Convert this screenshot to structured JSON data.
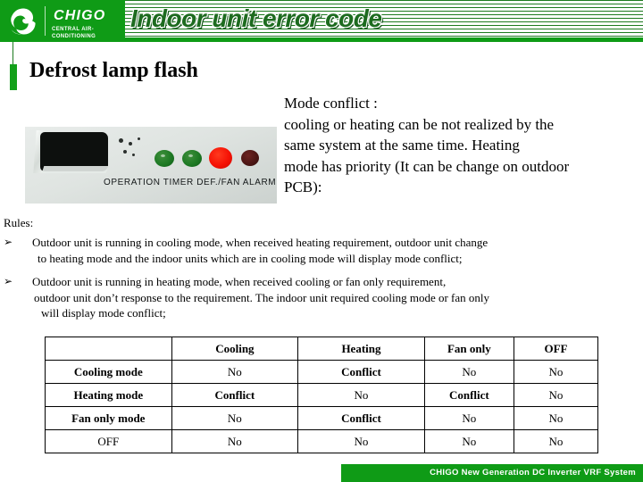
{
  "header": {
    "brand": "CHIGO",
    "brand_tagline": "CENTRAL AIR-CONDITIONING",
    "title": "Indoor unit error code",
    "green": "#0f9b16",
    "stripe_green": "#1d7a1f",
    "title_green": "#1d6b1f"
  },
  "slide": {
    "title": "Defrost lamp flash"
  },
  "photo": {
    "caption_labels": "OPERATION  TIMER  DEF./FAN  ALARM",
    "leds": [
      {
        "name": "operation-led",
        "color": "#1e7a24",
        "state": "green"
      },
      {
        "name": "timer-led",
        "color": "#1e7a24",
        "state": "green"
      },
      {
        "name": "defrost-fan-led",
        "color": "#f51205",
        "state": "red-on"
      },
      {
        "name": "alarm-led",
        "color": "#4a1513",
        "state": "off"
      }
    ]
  },
  "mode_conflict": {
    "lines": [
      "Mode conflict :",
      "cooling or heating can be not realized by the",
      "same system at the same time. Heating",
      "mode has priority (It can be change on outdoor",
      "PCB):"
    ]
  },
  "rules": {
    "label": "Rules:",
    "bullet_glyph": "➢",
    "items": [
      {
        "line1": "Outdoor unit is running in cooling mode, when received heating requirement, outdoor unit change",
        "line2": "to heating mode and the indoor units which are in cooling mode will display mode conflict;",
        "line3": ""
      },
      {
        "line1": "Outdoor unit is running in heating mode, when received cooling or fan only requirement,",
        "line2": "outdoor unit don’t response to the requirement. The indoor unit required cooling mode or fan only",
        "line3": "will display mode conflict;"
      }
    ]
  },
  "matrix": {
    "headers": [
      "",
      "Cooling",
      "Heating",
      "Fan only",
      "OFF"
    ],
    "rows": [
      {
        "label": "Cooling mode",
        "cells": [
          "No",
          "Conflict",
          "No",
          "No"
        ]
      },
      {
        "label": "Heating mode",
        "cells": [
          "Conflict",
          "No",
          "Conflict",
          "No"
        ]
      },
      {
        "label": "Fan only mode",
        "cells": [
          "No",
          "Conflict",
          "No",
          "No"
        ]
      },
      {
        "label": "OFF",
        "cells": [
          "No",
          "No",
          "No",
          "No"
        ]
      }
    ]
  },
  "footer": {
    "text": "CHIGO New Generation DC Inverter VRF System"
  }
}
